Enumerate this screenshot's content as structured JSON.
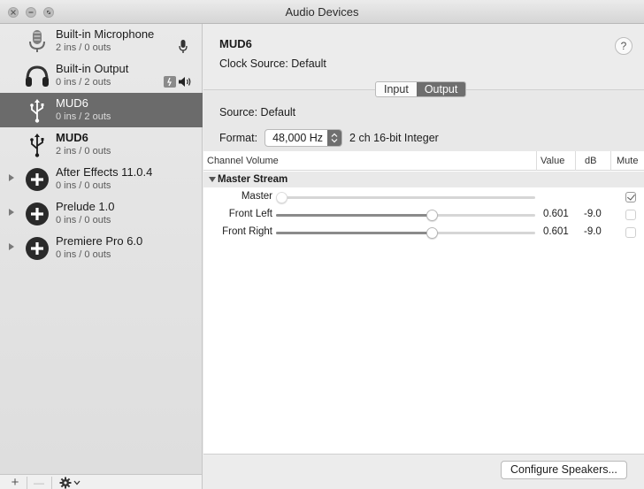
{
  "window": {
    "title": "Audio Devices"
  },
  "sidebar": {
    "devices": [
      {
        "name": "Built-in Microphone",
        "io": "2 ins / 0 outs",
        "icon": "microphone-icon",
        "side_icon": "mic-level-icon"
      },
      {
        "name": "Built-in Output",
        "io": "0 ins / 2 outs",
        "icon": "headphones-icon",
        "side_icon": "speaker-icon"
      },
      {
        "name": "MUD6",
        "io": "0 ins / 2 outs",
        "icon": "usb-icon",
        "selected": true
      },
      {
        "name": "MUD6",
        "io": "2 ins / 0 outs",
        "icon": "usb-icon"
      },
      {
        "name": "After Effects 11.0.4",
        "io": "0 ins / 0 outs",
        "icon": "aggregate-plus-icon"
      },
      {
        "name": "Prelude 1.0",
        "io": "0 ins / 0 outs",
        "icon": "aggregate-plus-icon"
      },
      {
        "name": "Premiere Pro 6.0",
        "io": "0 ins / 0 outs",
        "icon": "aggregate-plus-icon"
      }
    ],
    "add_label": "+",
    "remove_label": "—"
  },
  "main": {
    "device_title": "MUD6",
    "clock_source": "Clock Source:  Default",
    "help_label": "?",
    "tabs": [
      {
        "label": "Input",
        "active": false
      },
      {
        "label": "Output",
        "active": true
      }
    ],
    "source": "Source:  Default",
    "format_label": "Format:",
    "format_value": "48,000 Hz",
    "format_desc": "2 ch 16-bit Integer",
    "table": {
      "headers": [
        "Channel Volume",
        "Value",
        "dB",
        "Mute"
      ],
      "group": "Master Stream",
      "rows": [
        {
          "label": "Master",
          "value": "",
          "db": "",
          "level": 0,
          "muted": true,
          "disabled": true
        },
        {
          "label": "Front Left",
          "value": "0.601",
          "db": "-9.0",
          "level": 0.601,
          "muted": false,
          "disabled": false
        },
        {
          "label": "Front Right",
          "value": "0.601",
          "db": "-9.0",
          "level": 0.601,
          "muted": false,
          "disabled": false
        }
      ]
    },
    "configure_button": "Configure Speakers..."
  },
  "colors": {
    "selection": "#6b6b6b",
    "accent_tab": "#6e6e6e"
  }
}
